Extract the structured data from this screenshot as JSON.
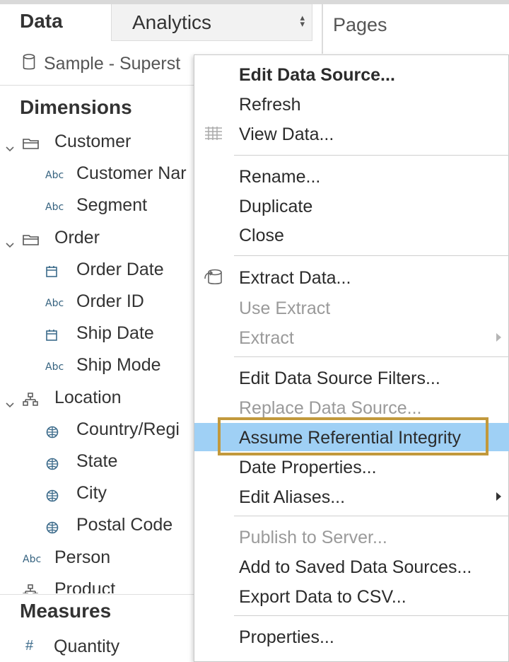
{
  "tabs": {
    "data": "Data",
    "analytics": "Analytics",
    "pages": "Pages"
  },
  "datasource": {
    "name": "Sample - Superst"
  },
  "dimensions": {
    "title": "Dimensions",
    "items": [
      {
        "label": "Customer",
        "icon": "folder-icon",
        "level": 0,
        "expanded": true
      },
      {
        "label": "Customer Nar",
        "icon": "abc-icon",
        "level": 1
      },
      {
        "label": "Segment",
        "icon": "abc-icon",
        "level": 1
      },
      {
        "label": "Order",
        "icon": "folder-icon",
        "level": 0,
        "expanded": true
      },
      {
        "label": "Order Date",
        "icon": "calendar-icon",
        "level": 1
      },
      {
        "label": "Order ID",
        "icon": "abc-icon",
        "level": 1
      },
      {
        "label": "Ship Date",
        "icon": "calendar-icon",
        "level": 1
      },
      {
        "label": "Ship Mode",
        "icon": "abc-icon",
        "level": 1
      },
      {
        "label": "Location",
        "icon": "hierarchy-icon",
        "level": 0,
        "expanded": true
      },
      {
        "label": "Country/Regi",
        "icon": "globe-icon",
        "level": 1
      },
      {
        "label": "State",
        "icon": "globe-icon",
        "level": 1
      },
      {
        "label": "City",
        "icon": "globe-icon",
        "level": 1
      },
      {
        "label": "Postal Code",
        "icon": "globe-icon",
        "level": 1
      },
      {
        "label": "Person",
        "icon": "abc-icon",
        "level": 0
      },
      {
        "label": "Product",
        "icon": "hierarchy-icon",
        "level": 0,
        "expanded": true
      }
    ]
  },
  "measures": {
    "title": "Measures",
    "items": [
      {
        "label": "Quantity",
        "icon": "hash-icon"
      }
    ]
  },
  "icon_text": {
    "abc": "Abc",
    "hash": "#"
  },
  "context_menu": {
    "items": [
      {
        "label": "Edit Data Source...",
        "bold": true
      },
      {
        "label": "Refresh"
      },
      {
        "label": "View Data...",
        "icon": "view-data-icon"
      },
      {
        "label": "Rename..."
      },
      {
        "label": "Duplicate"
      },
      {
        "label": "Close"
      },
      {
        "label": "Extract Data...",
        "icon": "extract-icon"
      },
      {
        "label": "Use Extract",
        "disabled": true
      },
      {
        "label": "Extract",
        "disabled": true,
        "submenu": true
      },
      {
        "label": "Edit Data Source Filters..."
      },
      {
        "label": "Replace Data Source...",
        "disabled": true
      },
      {
        "label": "Assume Referential Integrity",
        "highlighted": true
      },
      {
        "label": "Date Properties..."
      },
      {
        "label": "Edit Aliases...",
        "submenu": true
      },
      {
        "label": "Publish to Server...",
        "disabled": true
      },
      {
        "label": "Add to Saved Data Sources..."
      },
      {
        "label": "Export Data to CSV..."
      },
      {
        "label": "Properties..."
      }
    ]
  },
  "colors": {
    "highlight": "#9fd0f5",
    "callout": "#c2993c",
    "icon_blue": "#3b6a8a"
  }
}
